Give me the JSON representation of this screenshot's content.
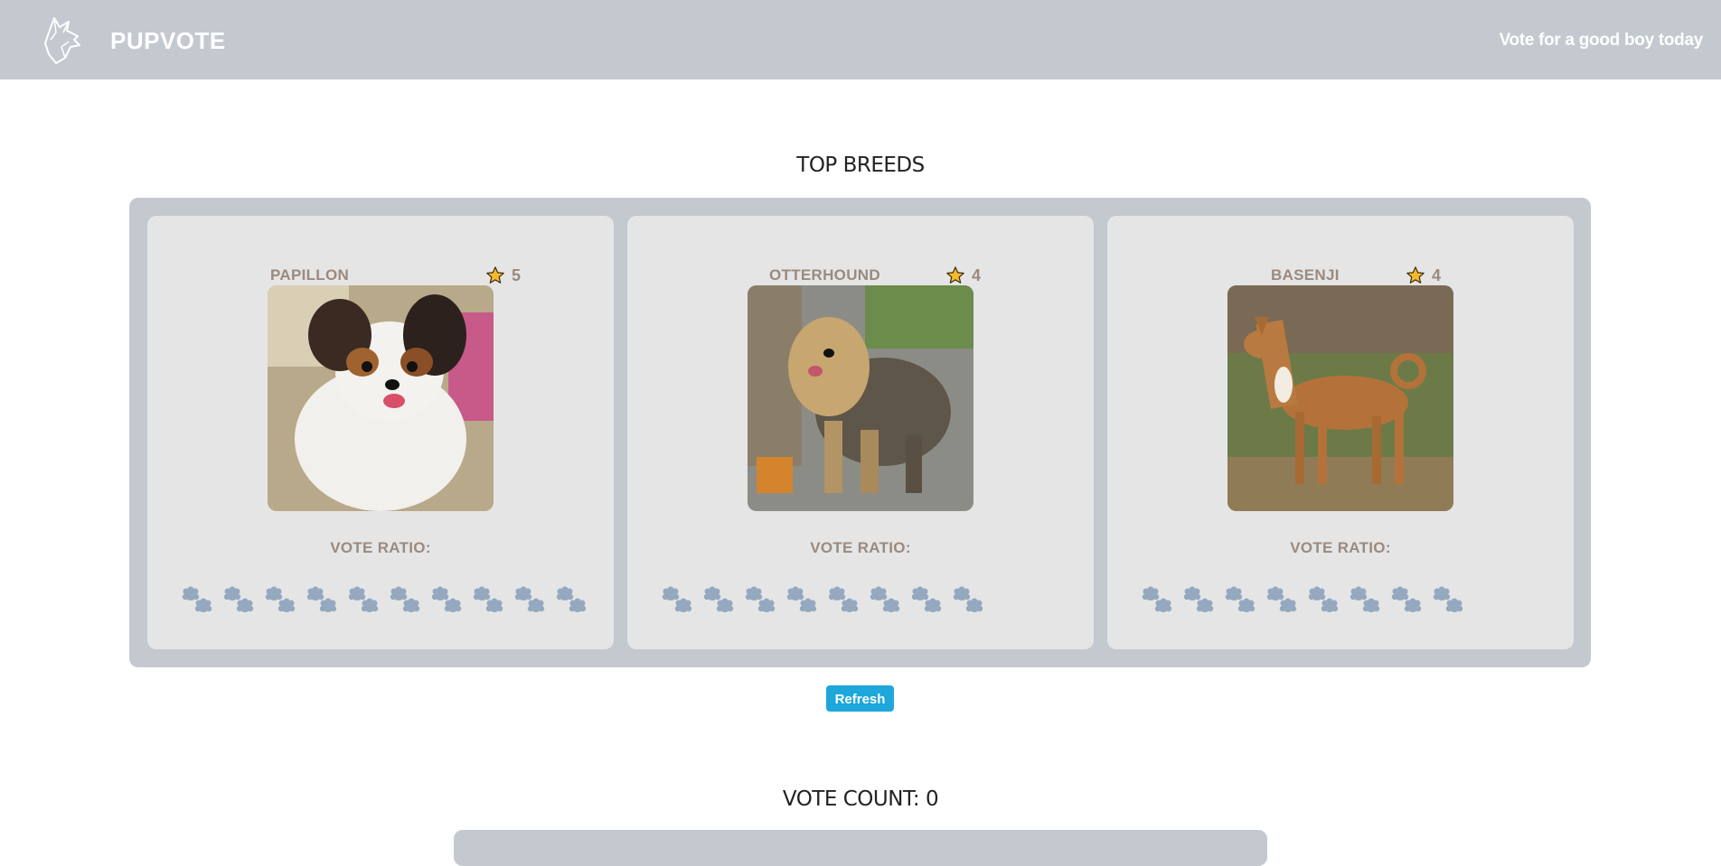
{
  "header": {
    "brand": "PUPVOTE",
    "tagline": "Vote for a good boy today",
    "logo_icon": "wolf-head-icon"
  },
  "top_breeds": {
    "title": "TOP BREEDS",
    "cards": [
      {
        "name": "PAPILLON",
        "rating": "5",
        "vote_label": "VOTE RATIO:",
        "paw_count": 10
      },
      {
        "name": "OTTERHOUND",
        "rating": "4",
        "vote_label": "VOTE RATIO:",
        "paw_count": 8
      },
      {
        "name": "BASENJI",
        "rating": "4",
        "vote_label": "VOTE RATIO:",
        "paw_count": 8
      }
    ]
  },
  "refresh_label": "Refresh",
  "vote_count": {
    "title": "VOTE COUNT: 0"
  },
  "colors": {
    "header_bg": "#c3c9cf",
    "card_bg": "#e5e5e5",
    "paw": "#94a9bf",
    "star": "#f5b92e",
    "button": "#1ea7db"
  }
}
